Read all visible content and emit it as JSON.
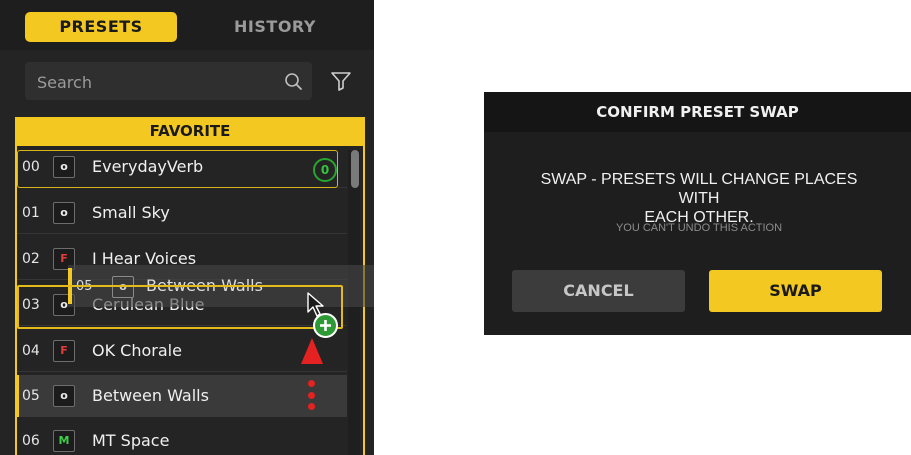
{
  "tabs": {
    "presets": "PRESETS",
    "history": "HISTORY"
  },
  "search": {
    "placeholder": "Search",
    "value": ""
  },
  "list": {
    "header": "FAVORITE",
    "count_badge": "0",
    "rows": [
      {
        "num": "00",
        "badge": "o",
        "name": "EverydayVerb",
        "badge_color": "#eaeaea"
      },
      {
        "num": "01",
        "badge": "o",
        "name": "Small Sky",
        "badge_color": "#eaeaea"
      },
      {
        "num": "02",
        "badge": "F",
        "name": "I Hear Voices",
        "badge_color": "#e53b3b"
      },
      {
        "num": "03",
        "badge": "o",
        "name": "Cerulean Blue",
        "badge_color": "#eaeaea"
      },
      {
        "num": "04",
        "badge": "F",
        "name": "OK Chorale",
        "badge_color": "#e53b3b"
      },
      {
        "num": "05",
        "badge": "o",
        "name": "Between Walls",
        "badge_color": "#eaeaea"
      },
      {
        "num": "06",
        "badge": "M",
        "name": "MT Space",
        "badge_color": "#3fcf4a"
      }
    ]
  },
  "drag_ghost": {
    "num": "05",
    "badge": "o",
    "name": "Between Walls"
  },
  "dialog": {
    "title": "CONFIRM PRESET SWAP",
    "message_line1": "SWAP - PRESETS WILL CHANGE PLACES WITH",
    "message_line2": "EACH OTHER.",
    "sub_message": "YOU CAN'T UNDO THIS ACTION",
    "cancel_label": "CANCEL",
    "swap_label": "SWAP"
  },
  "colors": {
    "accent": "#f3c820",
    "panel_bg": "#242424",
    "arrow": "#e52222",
    "plus": "#2e9a35"
  }
}
